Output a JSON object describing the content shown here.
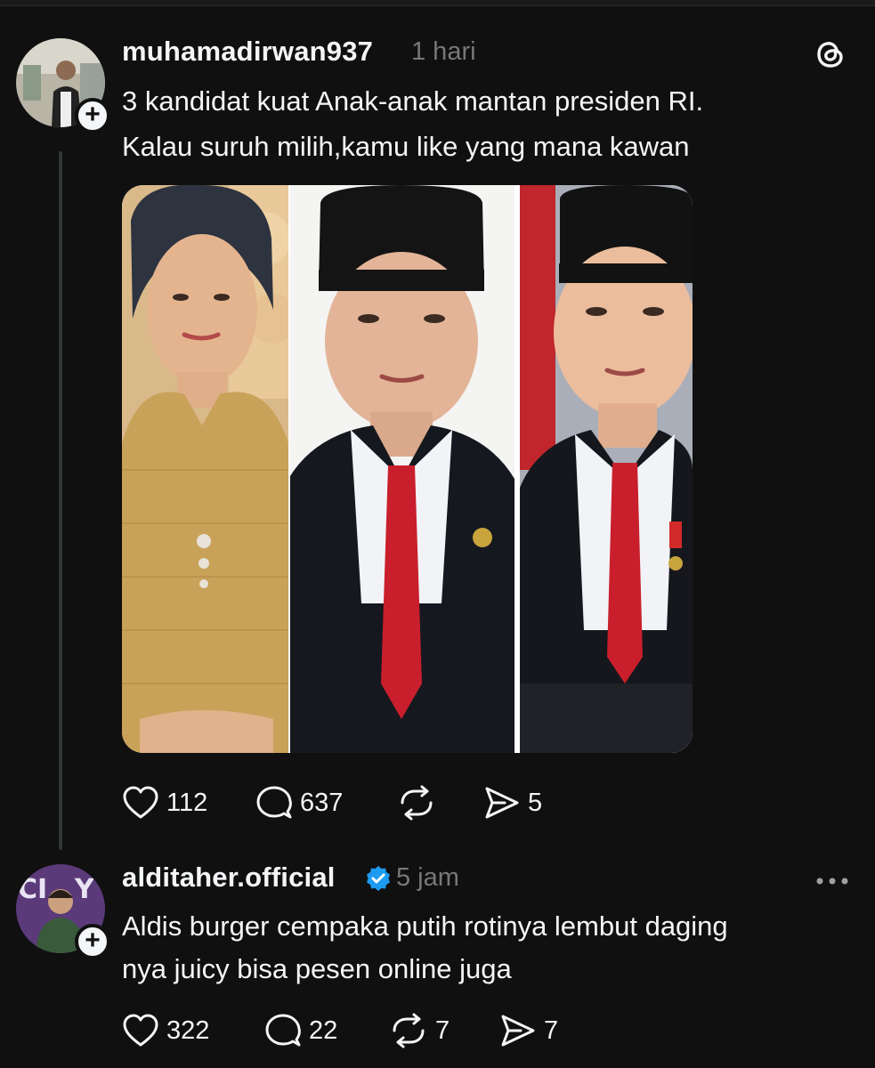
{
  "post": {
    "username": "muhamadirwan937",
    "time": "1 hari",
    "text_line1": "3 kandidat kuat Anak-anak mantan presiden RI.",
    "text_line2": "Kalau suruh milih,kamu like yang mana kawan",
    "likes": "112",
    "replies": "637",
    "shares": "5"
  },
  "reply": {
    "username": "alditaher.official",
    "time": "5 jam",
    "text_line1": "Aldis burger cempaka putih rotinya lembut daging",
    "text_line2": "nya juicy bisa pesen online juga",
    "likes": "322",
    "replies": "22",
    "reposts": "7",
    "shares": "7"
  },
  "icons": {
    "app": "threads-icon",
    "like": "heart-icon",
    "reply": "comment-icon",
    "repost": "repost-icon",
    "share": "send-icon",
    "verified": "verified-badge-icon",
    "more": "more-icon"
  },
  "colors": {
    "background": "#101010",
    "text": "#f3f5f7",
    "muted": "#777777",
    "verified": "#1d9bf0"
  }
}
